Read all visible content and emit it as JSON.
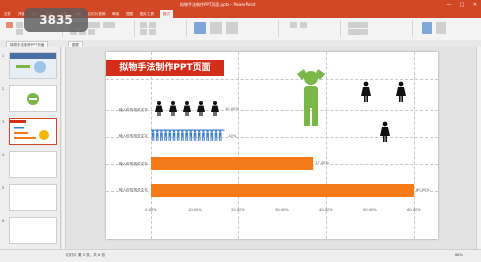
{
  "window": {
    "title": "拟物手法制作PPT页面.pptx - PowerPoint",
    "controls": [
      "—",
      "□",
      "✕"
    ]
  },
  "watermark": "3835",
  "ribbon": {
    "tabs": [
      "文件",
      "开始",
      "插入",
      "设计",
      "切换",
      "动画",
      "幻灯片放映",
      "审阅",
      "视图",
      "图片工具",
      "格式"
    ],
    "active_tab": "格式"
  },
  "doc_tabs": [
    "拟物手法制作PPT页面",
    "图表"
  ],
  "thumbnails": {
    "numbers": [
      "1",
      "2",
      "3",
      "4",
      "5",
      "6"
    ],
    "selected": "3"
  },
  "slide": {
    "title": "拟物手法制作PPT页面",
    "rows": [
      {
        "label": "输入你的相关文字",
        "value": 0.1,
        "value_label": "10.00%",
        "style": "woman-icons",
        "icon_count": 5
      },
      {
        "label": "输入你的相关文字",
        "value": 0.1,
        "value_label": "10%",
        "style": "figure-row",
        "icon_count": 17
      },
      {
        "label": "输入你的相关文字",
        "value": 0.37,
        "value_label": "37.00%",
        "style": "bar"
      },
      {
        "label": "输入你的相关文字",
        "value": 0.6,
        "value_label": "60.00%",
        "style": "bar"
      }
    ],
    "axis_ticks": [
      "0.00%",
      "10.00%",
      "20.00%",
      "30.00%",
      "40.00%",
      "50.00%",
      "60.00%"
    ],
    "colors": {
      "bar": "#f57b1a",
      "figure": "#3f7fd0",
      "accent_figure": "#7ab648",
      "title_bg": "#d42d1a"
    }
  },
  "status": {
    "left": "幻灯片 第 3 张，共 6 张",
    "zoom": "68%"
  }
}
